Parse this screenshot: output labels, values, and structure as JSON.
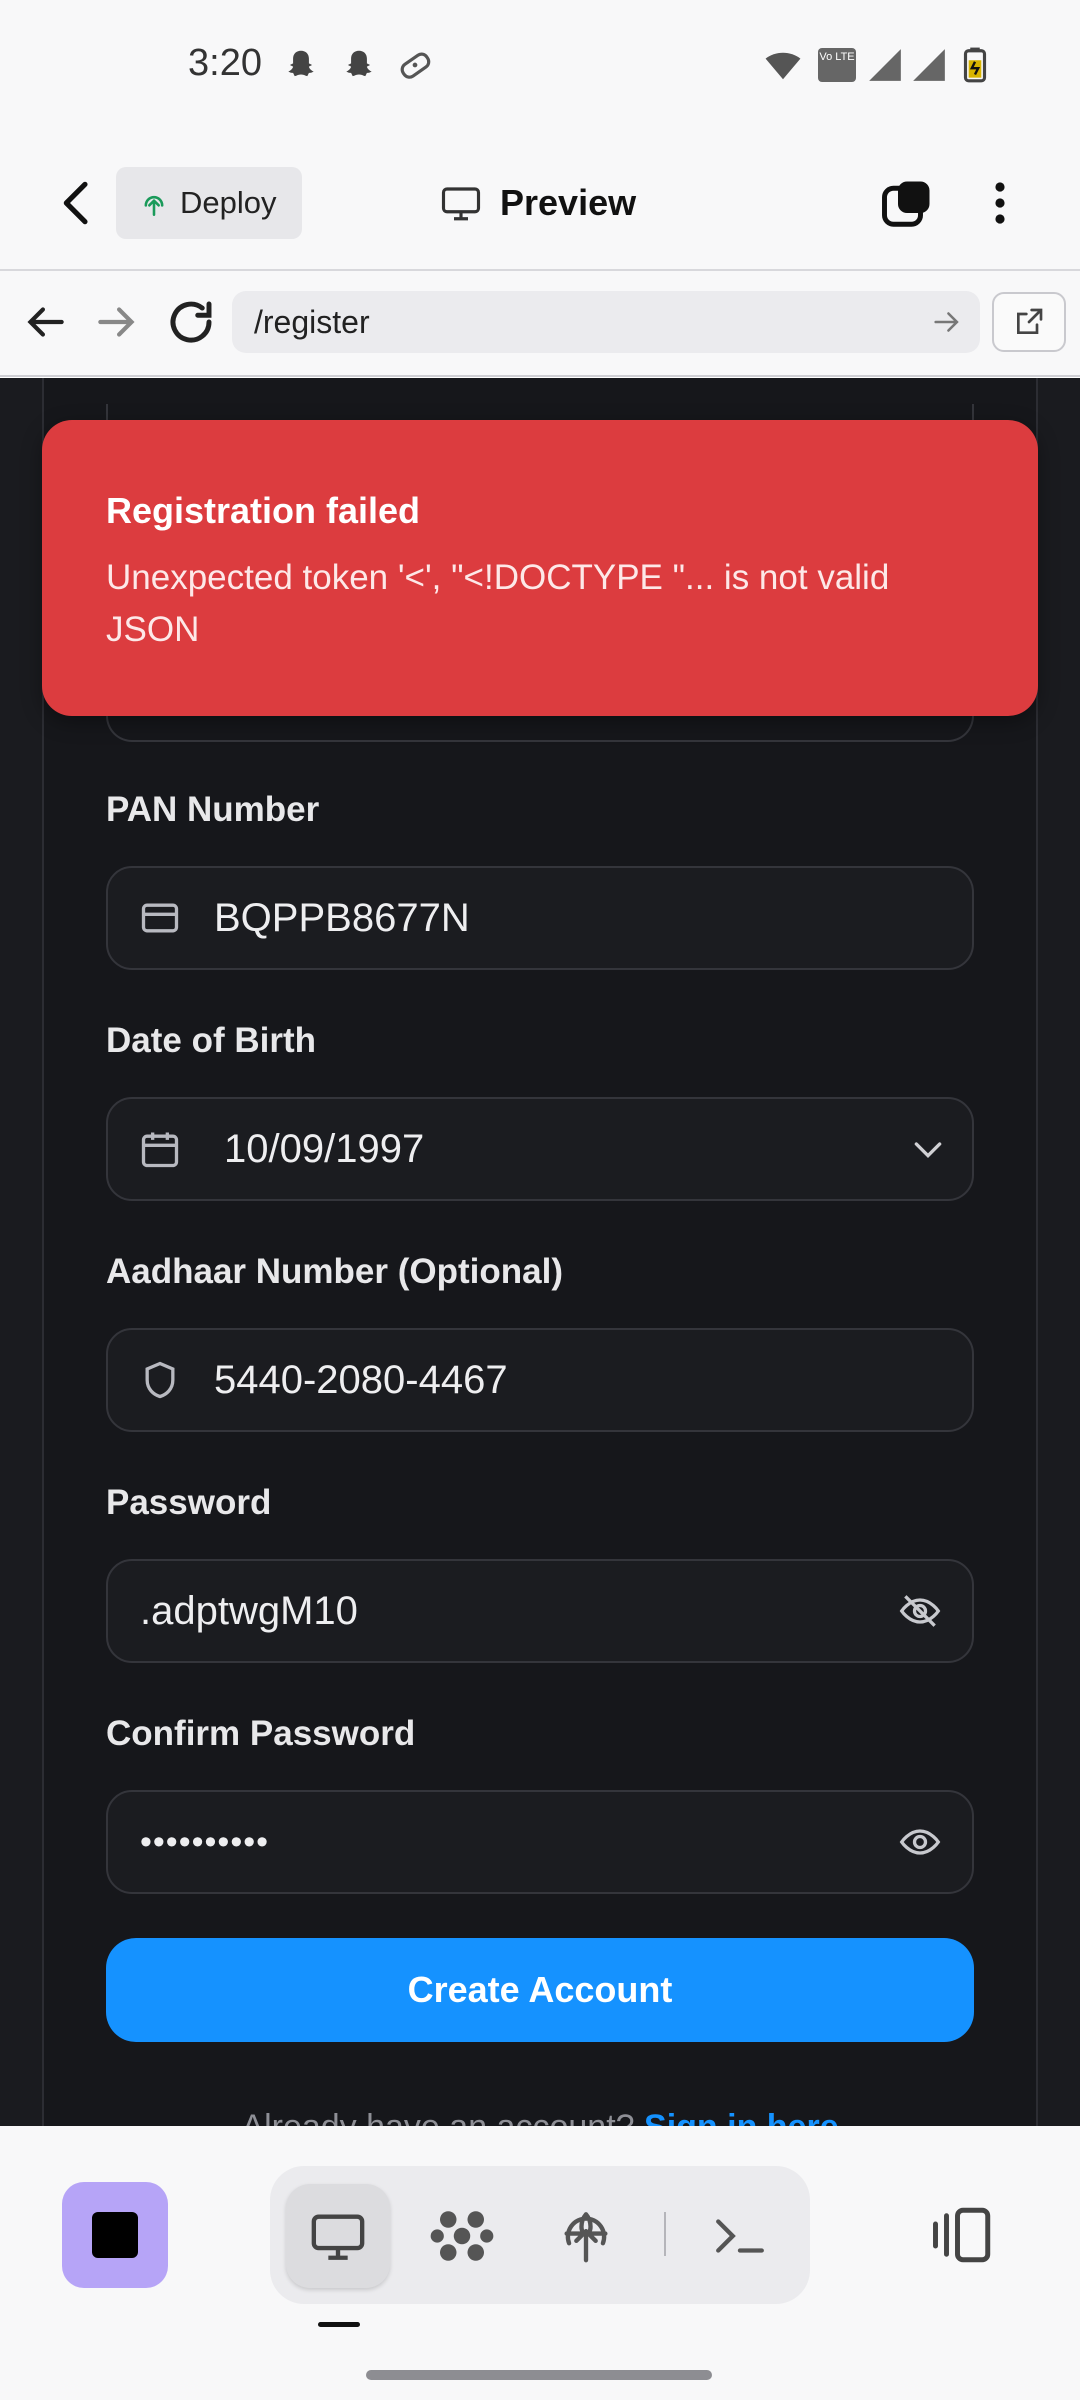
{
  "status_bar": {
    "time": "3:20",
    "left_icons": [
      "snapchat-icon",
      "snapchat-icon",
      "game-controller-icon"
    ],
    "right_icons": [
      "wifi-icon",
      "volte-icon",
      "signal-icon",
      "signal-icon",
      "battery-charging-icon"
    ],
    "volte_text": "Vo LTE"
  },
  "header": {
    "deploy_label": "Deploy",
    "preview_label": "Preview"
  },
  "browser": {
    "url": "/register"
  },
  "toast": {
    "title": "Registration failed",
    "message": "Unexpected token '<', \"<!DOCTYPE \"... is not valid JSON"
  },
  "form": {
    "pan": {
      "label": "PAN Number",
      "value": "BQPPB8677N"
    },
    "dob": {
      "label": "Date of Birth",
      "value": "10/09/1997"
    },
    "aadhaar": {
      "label": "Aadhaar Number (Optional)",
      "value": "5440-2080-4467"
    },
    "password": {
      "label": "Password",
      "value": ".adptwgM10"
    },
    "confirm_password": {
      "label": "Confirm Password",
      "value": "••••••••••"
    },
    "submit_label": "Create Account",
    "signin_prompt": "Already have an account?",
    "signin_link": "Sign in here"
  },
  "colors": {
    "primary": "#1592ff",
    "error": "#dc3c3f",
    "background": "#1a1b1f",
    "stop_button": "#b6a4f7"
  }
}
